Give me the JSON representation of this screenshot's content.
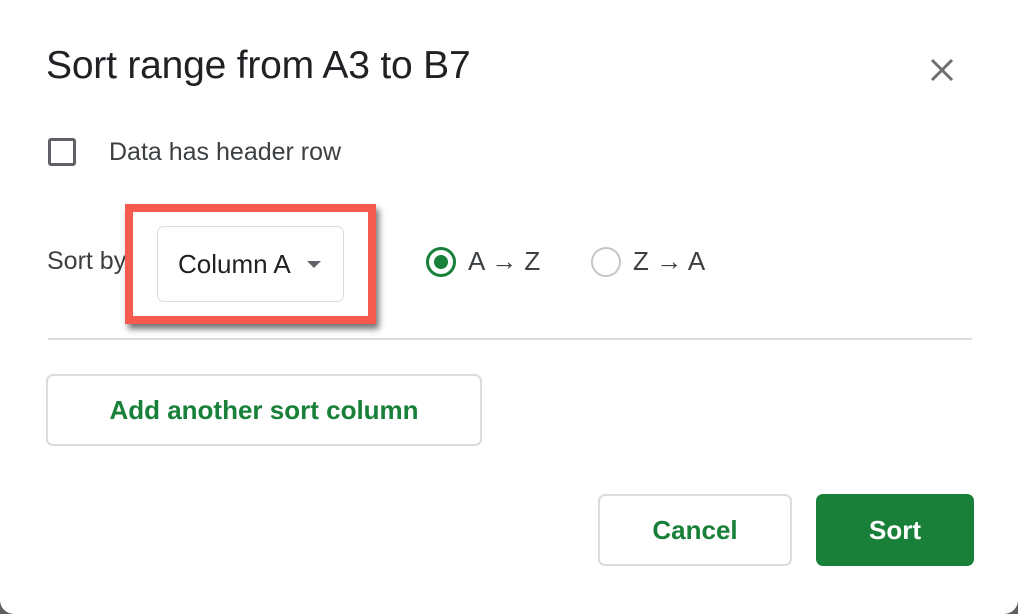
{
  "dialog": {
    "title": "Sort range from A3 to B7",
    "close_icon": "close-icon",
    "header_row": {
      "label": "Data has header row",
      "checked": false
    },
    "sort_by": {
      "label": "Sort by",
      "column": "Column A",
      "highlight_color": "#f55a4e"
    },
    "order": [
      {
        "label": "A → Z",
        "selected": true
      },
      {
        "label": "Z → A",
        "selected": false
      }
    ],
    "add_column_label": "Add another sort column",
    "cancel_label": "Cancel",
    "sort_label": "Sort",
    "accent_color": "#188038"
  }
}
